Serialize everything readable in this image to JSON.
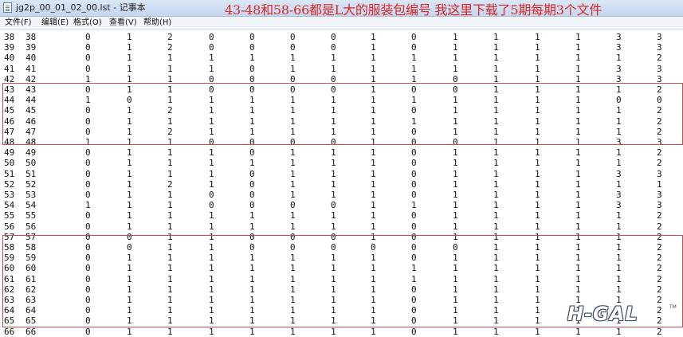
{
  "window": {
    "title": "jg2p_00_01_02_00.lst - 记事本"
  },
  "annotation": {
    "text": "43-48和58-66都是L大的服装包编号  我这里下载了5期每期3个文件"
  },
  "menu": [
    "文件(F)",
    "编辑(E)",
    "格式(O)",
    "查看(V)",
    "帮助(H)"
  ],
  "rows": [
    [
      "38",
      "38",
      "0",
      "1",
      "2",
      "0",
      "0",
      "0",
      "0",
      "1",
      "0",
      "1",
      "1",
      "1",
      "1",
      "3",
      "3"
    ],
    [
      "39",
      "39",
      "0",
      "1",
      "2",
      "0",
      "0",
      "0",
      "0",
      "1",
      "0",
      "1",
      "1",
      "1",
      "1",
      "3",
      "3"
    ],
    [
      "40",
      "40",
      "0",
      "1",
      "1",
      "1",
      "1",
      "1",
      "1",
      "1",
      "1",
      "1",
      "1",
      "1",
      "1",
      "1",
      "2"
    ],
    [
      "41",
      "41",
      "0",
      "1",
      "1",
      "1",
      "0",
      "1",
      "1",
      "1",
      "1",
      "1",
      "1",
      "1",
      "1",
      "3",
      "3"
    ],
    [
      "42",
      "42",
      "1",
      "1",
      "1",
      "0",
      "0",
      "0",
      "0",
      "1",
      "1",
      "0",
      "1",
      "1",
      "1",
      "3",
      "3"
    ],
    [
      "43",
      "43",
      "0",
      "1",
      "1",
      "0",
      "0",
      "0",
      "0",
      "1",
      "0",
      "0",
      "1",
      "1",
      "1",
      "1",
      "2"
    ],
    [
      "44",
      "44",
      "1",
      "0",
      "1",
      "1",
      "1",
      "1",
      "1",
      "1",
      "1",
      "1",
      "1",
      "1",
      "1",
      "0",
      "0"
    ],
    [
      "45",
      "45",
      "0",
      "1",
      "2",
      "1",
      "1",
      "1",
      "1",
      "1",
      "0",
      "1",
      "1",
      "1",
      "1",
      "1",
      "2"
    ],
    [
      "46",
      "46",
      "0",
      "1",
      "1",
      "1",
      "1",
      "1",
      "1",
      "1",
      "1",
      "1",
      "1",
      "1",
      "1",
      "1",
      "2"
    ],
    [
      "47",
      "47",
      "0",
      "1",
      "2",
      "1",
      "1",
      "1",
      "1",
      "1",
      "0",
      "1",
      "1",
      "1",
      "1",
      "1",
      "2"
    ],
    [
      "48",
      "48",
      "1",
      "1",
      "1",
      "0",
      "0",
      "0",
      "0",
      "1",
      "0",
      "0",
      "1",
      "1",
      "1",
      "3",
      "3"
    ],
    [
      "49",
      "49",
      "0",
      "1",
      "1",
      "1",
      "0",
      "1",
      "1",
      "1",
      "0",
      "1",
      "1",
      "1",
      "1",
      "1",
      "2"
    ],
    [
      "50",
      "50",
      "0",
      "1",
      "1",
      "1",
      "1",
      "1",
      "1",
      "1",
      "0",
      "1",
      "1",
      "1",
      "1",
      "1",
      "2"
    ],
    [
      "51",
      "51",
      "0",
      "1",
      "1",
      "1",
      "0",
      "1",
      "1",
      "1",
      "0",
      "1",
      "1",
      "1",
      "1",
      "3",
      "3"
    ],
    [
      "52",
      "52",
      "0",
      "1",
      "2",
      "1",
      "0",
      "1",
      "1",
      "1",
      "0",
      "1",
      "1",
      "1",
      "1",
      "1",
      "1"
    ],
    [
      "53",
      "53",
      "0",
      "1",
      "1",
      "0",
      "0",
      "1",
      "1",
      "1",
      "0",
      "1",
      "1",
      "1",
      "1",
      "3",
      "3"
    ],
    [
      "54",
      "54",
      "1",
      "1",
      "1",
      "0",
      "0",
      "0",
      "0",
      "1",
      "1",
      "1",
      "1",
      "1",
      "1",
      "3",
      "3"
    ],
    [
      "55",
      "55",
      "0",
      "1",
      "1",
      "1",
      "1",
      "1",
      "1",
      "1",
      "0",
      "1",
      "1",
      "1",
      "1",
      "1",
      "2"
    ],
    [
      "56",
      "56",
      "0",
      "1",
      "1",
      "1",
      "1",
      "1",
      "1",
      "1",
      "0",
      "1",
      "1",
      "1",
      "1",
      "1",
      "2"
    ],
    [
      "57",
      "57",
      "0",
      "0",
      "1",
      "1",
      "0",
      "0",
      "0",
      "1",
      "0",
      "1",
      "1",
      "1",
      "1",
      "1",
      "2"
    ],
    [
      "58",
      "58",
      "0",
      "0",
      "1",
      "1",
      "0",
      "0",
      "0",
      "0",
      "0",
      "0",
      "1",
      "1",
      "1",
      "1",
      "2"
    ],
    [
      "59",
      "59",
      "0",
      "1",
      "1",
      "1",
      "1",
      "1",
      "1",
      "1",
      "0",
      "1",
      "1",
      "1",
      "1",
      "1",
      "2"
    ],
    [
      "60",
      "60",
      "0",
      "1",
      "1",
      "1",
      "1",
      "1",
      "1",
      "1",
      "1",
      "1",
      "1",
      "1",
      "1",
      "1",
      "2"
    ],
    [
      "61",
      "61",
      "0",
      "1",
      "1",
      "1",
      "1",
      "1",
      "1",
      "1",
      "1",
      "1",
      "1",
      "1",
      "1",
      "1",
      "2"
    ],
    [
      "62",
      "62",
      "0",
      "1",
      "1",
      "1",
      "1",
      "1",
      "1",
      "1",
      "0",
      "1",
      "1",
      "1",
      "1",
      "1",
      "2"
    ],
    [
      "63",
      "63",
      "0",
      "1",
      "1",
      "1",
      "1",
      "1",
      "1",
      "1",
      "0",
      "1",
      "1",
      "1",
      "1",
      "1",
      "2"
    ],
    [
      "64",
      "64",
      "0",
      "1",
      "1",
      "1",
      "1",
      "1",
      "1",
      "1",
      "0",
      "1",
      "1",
      "1",
      "1",
      "1",
      "2"
    ],
    [
      "65",
      "65",
      "0",
      "1",
      "1",
      "1",
      "1",
      "1",
      "1",
      "1",
      "0",
      "1",
      "1",
      "1",
      "1",
      "1",
      "2"
    ],
    [
      "66",
      "66",
      "0",
      "1",
      "1",
      "1",
      "1",
      "1",
      "1",
      "1",
      "0",
      "1",
      "1",
      "1",
      "1",
      "1",
      "2"
    ]
  ],
  "watermark": {
    "text": "H-GAL",
    "tm": "TM"
  },
  "colors": {
    "annotation": "#d92727",
    "highlight_box": "#c0504d",
    "titlebar": "#c4d6ee"
  }
}
